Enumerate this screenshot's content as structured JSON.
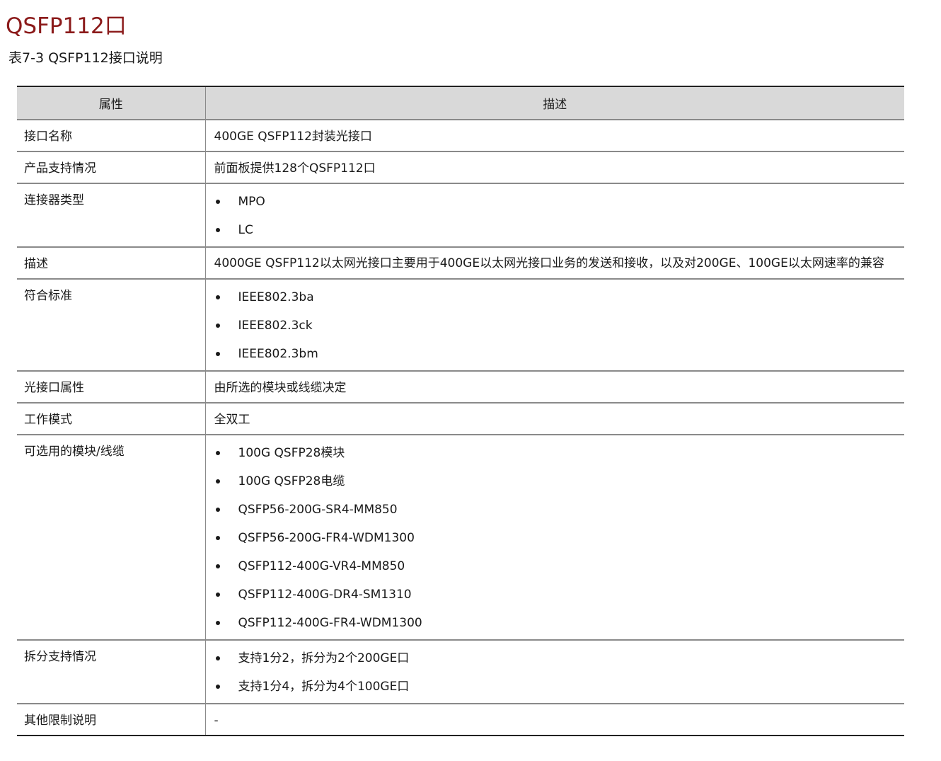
{
  "section_title": "QSFP112口",
  "table_caption": "表7-3 QSFP112接口说明",
  "table": {
    "headers": [
      "属性",
      "描述"
    ],
    "rows": [
      {
        "key": "接口名称",
        "text": "400GE QSFP112封装光接口"
      },
      {
        "key": "产品支持情况",
        "text": "前面板提供128个QSFP112口"
      },
      {
        "key": "连接器类型",
        "list": [
          "MPO",
          "LC"
        ]
      },
      {
        "key": "描述",
        "text": "4000GE QSFP112以太网光接口主要用于400GE以太网光接口业务的发送和接收，以及对200GE、100GE以太网速率的兼容"
      },
      {
        "key": "符合标准",
        "list": [
          "IEEE802.3ba",
          "IEEE802.3ck",
          "IEEE802.3bm"
        ]
      },
      {
        "key": "光接口属性",
        "text": "由所选的模块或线缆决定"
      },
      {
        "key": "工作模式",
        "text": "全双工"
      },
      {
        "key": "可选用的模块/线缆",
        "list": [
          "100G QSFP28模块",
          "100G QSFP28电缆",
          "QSFP56-200G-SR4-MM850",
          "QSFP56-200G-FR4-WDM1300",
          "QSFP112-400G-VR4-MM850",
          "QSFP112-400G-DR4-SM1310",
          "QSFP112-400G-FR4-WDM1300"
        ]
      },
      {
        "key": "拆分支持情况",
        "list": [
          "支持1分2，拆分为2个200GE口",
          "支持1分4，拆分为4个100GE口"
        ]
      },
      {
        "key": "其他限制说明",
        "text": "-"
      }
    ]
  }
}
